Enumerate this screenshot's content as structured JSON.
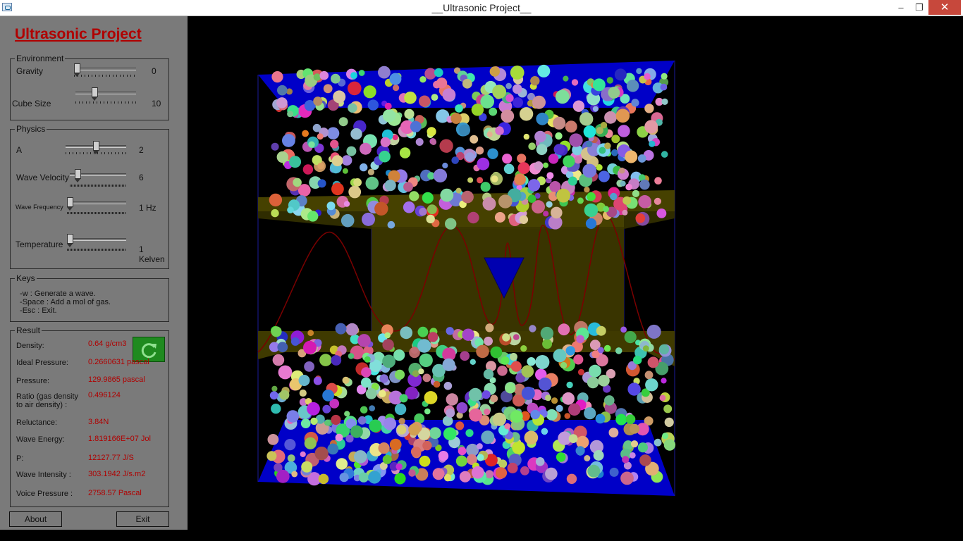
{
  "window": {
    "title": "__Ultrasonic Project__",
    "min_glyph": "–",
    "max_glyph": "❐",
    "close_glyph": "✕"
  },
  "app_title": "Ultrasonic Project",
  "environment": {
    "legend": "Environment",
    "gravity": {
      "label": "Gravity",
      "value": "0",
      "level": 0.0
    },
    "cube_size": {
      "label": "Cube Size",
      "value": "10",
      "level": 0.3
    }
  },
  "physics": {
    "legend": "Physics",
    "a": {
      "label": "A",
      "value": "2",
      "level": 0.5
    },
    "wave_velocity": {
      "label": "Wave Velocity",
      "value": "6",
      "level": 0.1
    },
    "wave_frequency": {
      "label": "Wave Frequency",
      "value": "1 Hz",
      "level": 0.0
    },
    "temperature": {
      "label": "Temperature",
      "value": "1 Kelven",
      "level": 0.0
    }
  },
  "keys": {
    "legend": "Keys",
    "text": " -w : Generate a wave.\n -Space : Add a mol of gas.\n -Esc : Exit."
  },
  "result": {
    "legend": "Result",
    "density": {
      "label": "Density:",
      "value": "0.64 g/cm3"
    },
    "ideal_pressure": {
      "label": "Ideal Pressure:",
      "value": "0.2660631 pascal"
    },
    "pressure": {
      "label": "Pressure:",
      "value": "129.9865 pascal"
    },
    "ratio": {
      "label": "Ratio (gas density\nto air density) :",
      "value": "0.496124"
    },
    "reluctance": {
      "label": "Reluctance:",
      "value": "3.84N"
    },
    "wave_energy": {
      "label": "Wave Energy:",
      "value": "1.819166E+07 Jol"
    },
    "p": {
      "label": "P:",
      "value": "12127.77 J/S"
    },
    "wave_intensity": {
      "label": "Wave Intensity :",
      "value": "303.1942 J/s.m2"
    },
    "voice_pressure": {
      "label": "Voice Pressure :",
      "value": "2758.57 Pascal"
    }
  },
  "buttons": {
    "about": "About",
    "exit": "Exit"
  },
  "colors": {
    "accent": "#b00000",
    "panel": "#7a7a7a",
    "cube_face": "#0000c8",
    "plate": "#4a4400",
    "wave": "#7a0000"
  }
}
